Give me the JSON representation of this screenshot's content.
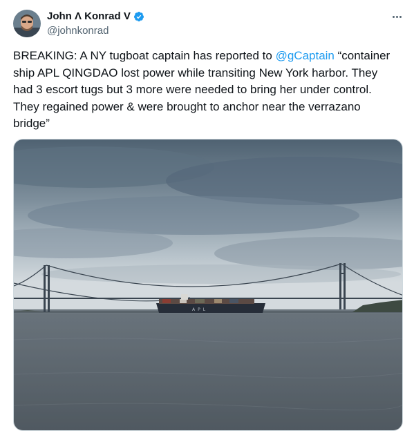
{
  "author": {
    "display_name": "John Λ Konrad V",
    "handle": "@johnkonrad",
    "verified": true,
    "avatar_icon": "avatar-photo"
  },
  "tweet": {
    "text_before_mention": "BREAKING: A NY tugboat captain has reported to ",
    "mention": "@gCaptain",
    "text_after_mention": " “container ship APL QINGDAO lost power while transiting New York harbor. They had 3 escort tugs but 3 more were needed to bring her under control. They regained power & were brought to anchor near the verrazano bridge”"
  },
  "media": {
    "ship_hull_text": "APL"
  },
  "icons": {
    "verified": "verified-badge-icon",
    "more": "more-options-icon"
  },
  "colors": {
    "accent": "#1d9bf0",
    "text": "#0f1419",
    "secondary_text": "#536471"
  }
}
